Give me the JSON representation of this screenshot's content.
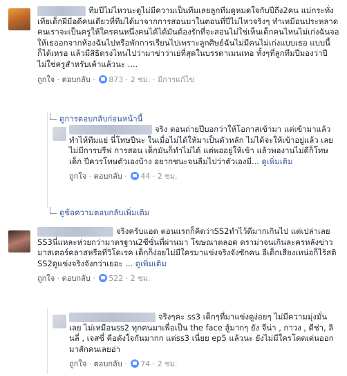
{
  "c1": {
    "text": "ทีมปีไม่ไหวนะดูไม่มีความเป็นทีมเลยลูกทีมดูหมดใจกับปีถึง2คน แม่กระทั่งเทียเด็กฝีมือดีคนเดียวที่ทีมได้มาจากการสอนมาในตอนที่ปีไม่ไหวจริงๆ ทำเหมือนประหลาดคนเราจะเป็นครูให้ใครคนหนึ่งคนได้ได้มันต้องรักที่จะสอนไม่ใช่เห็นเด็กคนไหนไม่เก่งฉันจอให้เธออกจากห้องฉันไปหรือพักการเรียนไปเพราะลูกศิษย์ฉันไม่มีคนไม่เก่งแบบเธอ แบบนี้ก็ได้เหรอ แล้วมีสิธิตรงไหนไปว่ามาข่าว่าเย่ที่สุดในบรรดาเมนเทอ ทั้งๆที่ลูกทีมปีมองว่าปีไม่ใช่ครูสำหรับเค้าแล้วนะ ....",
    "like": "ถูกใจ",
    "reply": "ตอบกลับ",
    "count": "873",
    "time": "2 ชม.",
    "edited": "มีการแก้ไข"
  },
  "prev_replies": "ดูการตอบกลับก่อนหน้านี้",
  "r1": {
    "text": "จริง ตอนถ่ายปีบอกว่าให้โอกาสเข้ามา แต่เข้ามาแล้วทำไห้ทีมแย่ นี่โทษปีนะ ในเมื่อไม่ได้ให้มาเป็นตัวหลัก ไม่ได้จะให้เข้าอยู่แล้ว เลยไม่มีการบรีฟ การสอน เด็กมันก็ทำไม่ได้ แต่พออยู่ให้เข้า แล้วพองานไม่ดีก็โทษเด็ก ปีควรโทษตัวเองบ้าง อยากชนะจนลืมไปว่าตัวเองมี...",
    "see_more": "ดูเพิ่มเติม",
    "like": "ถูกใจ",
    "reply": "ตอบกลับ",
    "count": "44",
    "time": "2 ชม."
  },
  "more_replies": "ดูข้อความตอบกลับเพิ่มเติม",
  "c2": {
    "text": "จริงครับแอด ตอนแรกก็คิดว่าSS2ทำไว้ดีมากเกินไป แต่เปล่าเลย SS3นี่แหละห่วยกว่ามาตรฐาน2ซีซั่นที่ผ่านมา โฆษณาตลอด ดราม่าจนเกินละครหลังข่าว มาสเตอร์คลาสหรือที่วิโดเรค เด็กก็ง่อยไม่มีใครมาแข่งจริงจังซักคน อีเด็กเสียงเหน่อก็ไร้สติ SS2ดูแข่งจริงจังกว่าเยอะ ...",
    "see_more": "ดูเพิ่มเติม",
    "like": "ถูกใจ",
    "reply": "ตอบกลับ",
    "count": "522",
    "time": "2 ชม."
  },
  "r2": {
    "text": "จริงๆคะ ss3 เด็กๆที่มาแข่งดูง่อยๆ ไม่มีความมุ่งมั่นเลย ไม่เหมือนss2 ทุกคนมาเพื่อเป็น the face สู้มากๆ ยัง จีน่า , กาวง , ดีช่า, ลินลี่ , เจสซี่ คือดังใจกันมากก แต่ss3 เนี่ยย ep5 แล้วนะ ยังไม่มีใครโดดเด่นออกมาสักคนเลยอ่า",
    "like": "ถูกใจ",
    "reply": "ตอบกลับ",
    "count": "74",
    "time": "2 ชม."
  }
}
